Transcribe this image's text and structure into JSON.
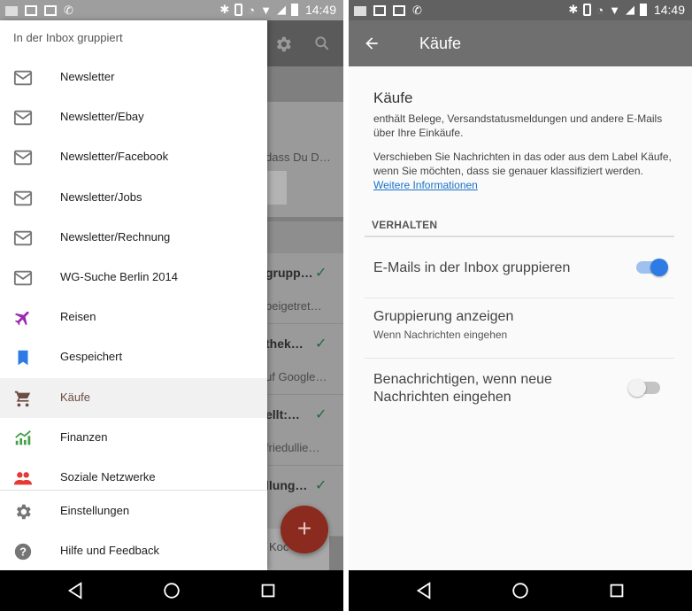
{
  "status_bar": {
    "time": "14:49"
  },
  "left": {
    "drawer": {
      "header": "In der Inbox gruppiert",
      "items": [
        {
          "label": "Newsletter",
          "icon": "mail-icon",
          "color": "#757575"
        },
        {
          "label": "Newsletter/Ebay",
          "icon": "mail-icon",
          "color": "#757575"
        },
        {
          "label": "Newsletter/Facebook",
          "icon": "mail-icon",
          "color": "#757575"
        },
        {
          "label": "Newsletter/Jobs",
          "icon": "mail-icon",
          "color": "#757575"
        },
        {
          "label": "Newsletter/Rechnung",
          "icon": "mail-icon",
          "color": "#757575"
        },
        {
          "label": "WG-Suche Berlin 2014",
          "icon": "mail-icon",
          "color": "#757575"
        },
        {
          "label": "Reisen",
          "icon": "airplane-icon",
          "color": "#9c27b0"
        },
        {
          "label": "Gespeichert",
          "icon": "bookmark-icon",
          "color": "#2f7be5"
        },
        {
          "label": "Käufe",
          "icon": "cart-icon",
          "color": "#6d4c41",
          "active": true
        },
        {
          "label": "Finanzen",
          "icon": "chart-icon",
          "color": "#43a047"
        },
        {
          "label": "Soziale Netzwerke",
          "icon": "people-icon",
          "color": "#e53935"
        }
      ],
      "footer": [
        {
          "label": "Einstellungen",
          "icon": "gear-icon"
        },
        {
          "label": "Hilfe und Feedback",
          "icon": "help-icon"
        }
      ]
    },
    "background": {
      "snippet1": "dass Du D…",
      "rows": [
        {
          "title": "grupp…",
          "sub": "beigetret…"
        },
        {
          "title": "thek…",
          "sub": "uf Google…"
        },
        {
          "title": "ellt:…",
          "sub": "friedullie…"
        },
        {
          "title": "llung…",
          "sub": ""
        }
      ],
      "fab": "+",
      "koc": "Koc"
    }
  },
  "right": {
    "toolbar_title": "Käufe",
    "heading": "Käufe",
    "description": "enthält Belege, Versandstatusmeldungen und andere E-Mails über Ihre Einkäufe.",
    "move_text": "Verschieben Sie Nachrichten in das oder aus dem Label Käufe, wenn Sie möchten, dass sie genauer klassifiziert werden.",
    "link": "Weitere Informationen",
    "section": "VERHALTEN",
    "settings": [
      {
        "title": "E-Mails in der Inbox gruppieren",
        "toggle": "on"
      },
      {
        "title": "Gruppierung anzeigen",
        "subtitle": "Wenn Nachrichten eingehen"
      },
      {
        "title": "Benachrichtigen, wenn neue Nachrichten eingehen",
        "toggle": "off"
      }
    ]
  }
}
